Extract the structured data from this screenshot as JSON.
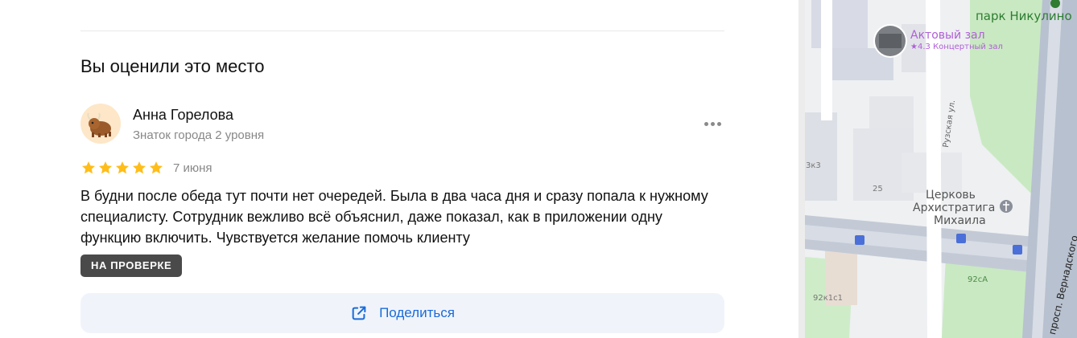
{
  "review_section": {
    "title": "Вы оценили это место",
    "author": {
      "name": "Анна Горелова",
      "level": "Знаток города 2 уровня"
    },
    "rating": 5,
    "date": "7 июня",
    "text": "В будни после обеда тут почти нет очередей. Была в два часа дня и сразу попала к нужному специалисту. Сотрудник вежливо всё объяснил, даже показал, как в приложении одну функцию включить. Чувствуется желание помочь клиенту",
    "status_badge": "НА ПРОВЕРКЕ",
    "share_label": "Поделиться",
    "more_icon": "more-dots-icon",
    "share_icon": "external-link-icon",
    "star_color": "#ffbd1a",
    "accent_color": "#1a6bd9"
  },
  "map": {
    "park_label": "парк Никулино",
    "poi": {
      "name": "Актовый зал",
      "rating": "★4.3",
      "category": "Концертный зал"
    },
    "street_ruzskaya": "Рузская ул.",
    "church_lines": [
      "Церковь",
      "Архистратига",
      "Михаила"
    ],
    "avenue": "просп. Вернадского",
    "house_numbers": [
      "3к3",
      "25",
      "92сА",
      "92к1с1"
    ],
    "poi_color": "#b05fd6",
    "park_color": "#2e7d32"
  }
}
